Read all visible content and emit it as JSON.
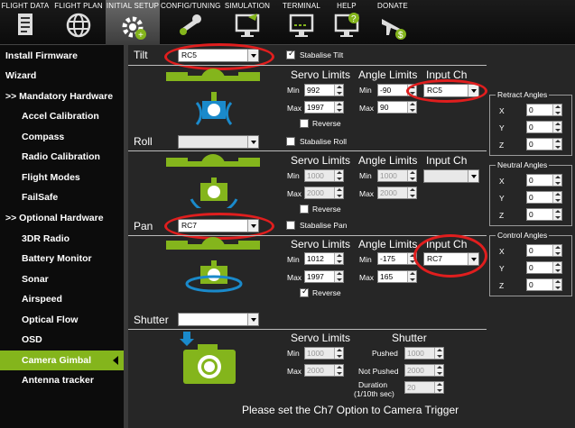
{
  "tabs": [
    {
      "label": "FLIGHT DATA",
      "icon": "flight-data-icon"
    },
    {
      "label": "FLIGHT PLAN",
      "icon": "flight-plan-globe-icon"
    },
    {
      "label": "INITIAL SETUP",
      "icon": "initial-setup-gear-icon"
    },
    {
      "label": "CONFIG/TUNING",
      "icon": "config-wrench-icon"
    },
    {
      "label": "SIMULATION",
      "icon": "simulation-monitor-icon"
    },
    {
      "label": "TERMINAL",
      "icon": "terminal-monitor-icon"
    },
    {
      "label": "HELP",
      "icon": "help-monitor-icon"
    },
    {
      "label": "DONATE",
      "icon": "donate-plane-icon"
    }
  ],
  "sidebar": [
    {
      "label": "Install Firmware"
    },
    {
      "label": "Wizard"
    },
    {
      "label": ">> Mandatory Hardware"
    },
    {
      "label": "Accel Calibration"
    },
    {
      "label": "Compass"
    },
    {
      "label": "Radio Calibration"
    },
    {
      "label": "Flight Modes"
    },
    {
      "label": "FailSafe"
    },
    {
      "label": ">> Optional Hardware"
    },
    {
      "label": "3DR Radio"
    },
    {
      "label": "Battery Monitor"
    },
    {
      "label": "Sonar"
    },
    {
      "label": "Airspeed"
    },
    {
      "label": "Optical Flow"
    },
    {
      "label": "OSD"
    },
    {
      "label": "Camera Gimbal"
    },
    {
      "label": "Antenna tracker"
    }
  ],
  "labels": {
    "servo_limits": "Servo Limits",
    "angle_limits": "Angle Limits",
    "input_ch": "Input Ch",
    "min": "Min",
    "max": "Max",
    "reverse": "Reverse",
    "shutter_col": "Shutter",
    "pushed": "Pushed",
    "not_pushed": "Not Pushed",
    "duration": "Duration",
    "duration2": "(1/10th sec)"
  },
  "tilt": {
    "label": "Tilt",
    "channel": "RC5",
    "stabilise": "Stabalise Tilt",
    "servo_min": "992",
    "servo_max": "1997",
    "angle_min": "-90",
    "angle_max": "90",
    "input": "RC5"
  },
  "roll": {
    "label": "Roll",
    "channel": "",
    "stabilise": "Stabalise Roll",
    "servo_min": "1000",
    "servo_max": "2000",
    "angle_min": "1000",
    "angle_max": "2000",
    "input": ""
  },
  "pan": {
    "label": "Pan",
    "channel": "RC7",
    "stabilise": "Stabalise Pan",
    "servo_min": "1012",
    "servo_max": "1997",
    "angle_min": "-175",
    "angle_max": "165",
    "input": "RC7"
  },
  "shutter": {
    "label": "Shutter",
    "channel": "",
    "servo_min": "1000",
    "servo_max": "2000",
    "pushed": "1000",
    "not_pushed": "2000",
    "duration": "20"
  },
  "retract": {
    "title": "Retract Angles",
    "x": "0",
    "y": "0",
    "z": "0"
  },
  "neutral": {
    "title": "Neutral Angles",
    "x": "0",
    "y": "0",
    "z": "0"
  },
  "control": {
    "title": "Control Angles",
    "x": "0",
    "y": "0",
    "z": "0"
  },
  "axes": {
    "x": "X",
    "y": "Y",
    "z": "Z"
  },
  "footer": "Please set the Ch7 Option to Camera Trigger",
  "colors": {
    "accent": "#84b51c",
    "highlight": "#e01e1e"
  }
}
